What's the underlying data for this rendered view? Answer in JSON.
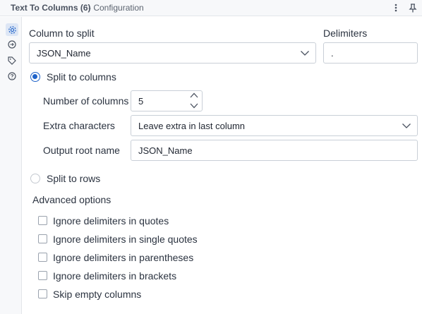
{
  "header": {
    "tool_name": "Text To Columns (6)",
    "subtitle": "- Configuration",
    "menu_icon": "kebab-menu-icon",
    "pin_icon": "pin-icon"
  },
  "sidebar": {
    "items": [
      {
        "icon": "gear-icon",
        "active": true
      },
      {
        "icon": "connection-icon",
        "active": false
      },
      {
        "icon": "tag-icon",
        "active": false
      },
      {
        "icon": "help-icon",
        "active": false
      }
    ]
  },
  "config": {
    "column_label": "Column to split",
    "column_value": "JSON_Name",
    "delimiters_label": "Delimiters",
    "delimiters_value": ".",
    "split_columns_label": "Split to columns",
    "split_columns_checked": true,
    "num_columns_label": "Number of columns",
    "num_columns_value": "5",
    "extra_chars_label": "Extra characters",
    "extra_chars_value": "Leave extra in last column",
    "output_root_label": "Output root name",
    "output_root_value": "JSON_Name",
    "split_rows_label": "Split to rows",
    "split_rows_checked": false
  },
  "advanced": {
    "title": "Advanced options",
    "options": [
      {
        "label": "Ignore delimiters in quotes",
        "checked": false
      },
      {
        "label": "Ignore delimiters in single quotes",
        "checked": false
      },
      {
        "label": "Ignore delimiters in parentheses",
        "checked": false
      },
      {
        "label": "Ignore delimiters in brackets",
        "checked": false
      },
      {
        "label": "Skip empty columns",
        "checked": false
      }
    ]
  },
  "colors": {
    "accent": "#1f63c9",
    "border": "#c9cfd7",
    "text": "#2b3340",
    "panel_bg": "#f7f8fa"
  }
}
